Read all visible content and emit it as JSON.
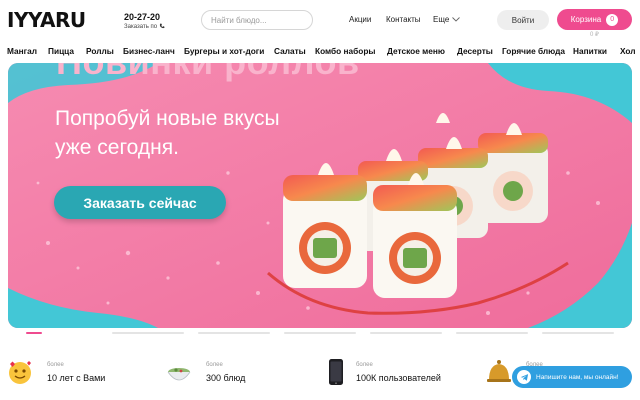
{
  "header": {
    "logo": "IYYARU",
    "phone": "20-27-20",
    "phone_sub": "Заказать по",
    "search_placeholder": "Найти блюдо...",
    "nav": [
      "Акции",
      "Контакты"
    ],
    "more_label": "Еще",
    "login_label": "Войти",
    "cart_label": "Корзина",
    "cart_count": "0",
    "cart_total": "0 ₽"
  },
  "categories": [
    "Мангал",
    "Пицца",
    "Роллы",
    "Бизнес-ланч",
    "Бургеры и хот-доги",
    "Салаты",
    "Комбо наборы",
    "Детское меню",
    "Десерты",
    "Горячие блюда",
    "Напитки",
    "Хол"
  ],
  "banner": {
    "heading": "Новинки роллов",
    "subtitle_line1": "Попробуй новые вкусы",
    "subtitle_line2": "уже сегодня.",
    "button_label": "Заказать сейчас"
  },
  "slider": {
    "count": 7,
    "active_index": 0
  },
  "stats": [
    {
      "small": "более",
      "big": "10 лет с Вами",
      "icon": "smiling-face-icon"
    },
    {
      "small": "более",
      "big": "300 блюд",
      "icon": "bowl-icon"
    },
    {
      "small": "более",
      "big": "100К пользователей",
      "icon": "smartphone-icon"
    },
    {
      "small": "более",
      "big": "",
      "icon": "bell-icon"
    }
  ],
  "telegram_button": "Напишите нам, мы онлайн!",
  "colors": {
    "accent": "#ef4b8f",
    "button_teal": "#2aa7b3",
    "telegram": "#2f9fe0",
    "banner_bg": "#f47ba4"
  }
}
